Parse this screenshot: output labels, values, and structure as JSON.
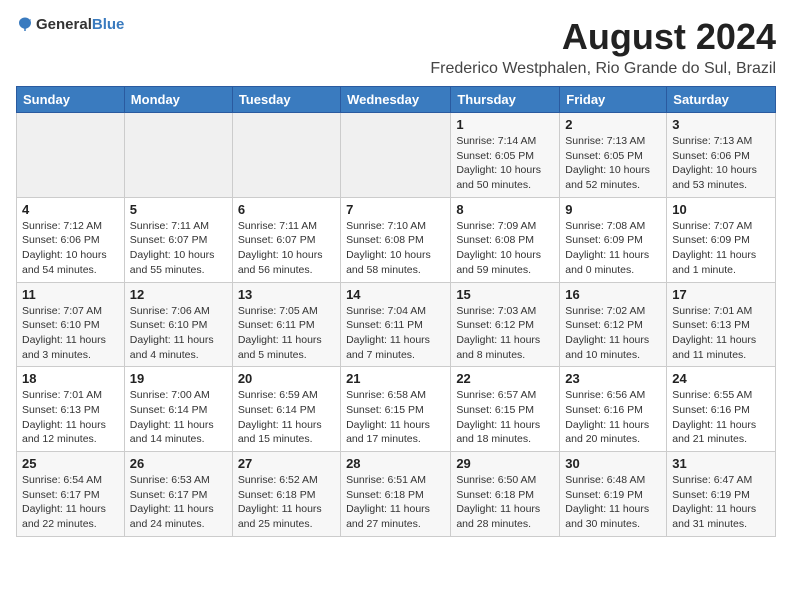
{
  "header": {
    "logo_general": "General",
    "logo_blue": "Blue",
    "title": "August 2024",
    "subtitle": "Frederico Westphalen, Rio Grande do Sul, Brazil"
  },
  "weekdays": [
    "Sunday",
    "Monday",
    "Tuesday",
    "Wednesday",
    "Thursday",
    "Friday",
    "Saturday"
  ],
  "weeks": [
    [
      {
        "day": "",
        "info": ""
      },
      {
        "day": "",
        "info": ""
      },
      {
        "day": "",
        "info": ""
      },
      {
        "day": "",
        "info": ""
      },
      {
        "day": "1",
        "info": "Sunrise: 7:14 AM\nSunset: 6:05 PM\nDaylight: 10 hours\nand 50 minutes."
      },
      {
        "day": "2",
        "info": "Sunrise: 7:13 AM\nSunset: 6:05 PM\nDaylight: 10 hours\nand 52 minutes."
      },
      {
        "day": "3",
        "info": "Sunrise: 7:13 AM\nSunset: 6:06 PM\nDaylight: 10 hours\nand 53 minutes."
      }
    ],
    [
      {
        "day": "4",
        "info": "Sunrise: 7:12 AM\nSunset: 6:06 PM\nDaylight: 10 hours\nand 54 minutes."
      },
      {
        "day": "5",
        "info": "Sunrise: 7:11 AM\nSunset: 6:07 PM\nDaylight: 10 hours\nand 55 minutes."
      },
      {
        "day": "6",
        "info": "Sunrise: 7:11 AM\nSunset: 6:07 PM\nDaylight: 10 hours\nand 56 minutes."
      },
      {
        "day": "7",
        "info": "Sunrise: 7:10 AM\nSunset: 6:08 PM\nDaylight: 10 hours\nand 58 minutes."
      },
      {
        "day": "8",
        "info": "Sunrise: 7:09 AM\nSunset: 6:08 PM\nDaylight: 10 hours\nand 59 minutes."
      },
      {
        "day": "9",
        "info": "Sunrise: 7:08 AM\nSunset: 6:09 PM\nDaylight: 11 hours\nand 0 minutes."
      },
      {
        "day": "10",
        "info": "Sunrise: 7:07 AM\nSunset: 6:09 PM\nDaylight: 11 hours\nand 1 minute."
      }
    ],
    [
      {
        "day": "11",
        "info": "Sunrise: 7:07 AM\nSunset: 6:10 PM\nDaylight: 11 hours\nand 3 minutes."
      },
      {
        "day": "12",
        "info": "Sunrise: 7:06 AM\nSunset: 6:10 PM\nDaylight: 11 hours\nand 4 minutes."
      },
      {
        "day": "13",
        "info": "Sunrise: 7:05 AM\nSunset: 6:11 PM\nDaylight: 11 hours\nand 5 minutes."
      },
      {
        "day": "14",
        "info": "Sunrise: 7:04 AM\nSunset: 6:11 PM\nDaylight: 11 hours\nand 7 minutes."
      },
      {
        "day": "15",
        "info": "Sunrise: 7:03 AM\nSunset: 6:12 PM\nDaylight: 11 hours\nand 8 minutes."
      },
      {
        "day": "16",
        "info": "Sunrise: 7:02 AM\nSunset: 6:12 PM\nDaylight: 11 hours\nand 10 minutes."
      },
      {
        "day": "17",
        "info": "Sunrise: 7:01 AM\nSunset: 6:13 PM\nDaylight: 11 hours\nand 11 minutes."
      }
    ],
    [
      {
        "day": "18",
        "info": "Sunrise: 7:01 AM\nSunset: 6:13 PM\nDaylight: 11 hours\nand 12 minutes."
      },
      {
        "day": "19",
        "info": "Sunrise: 7:00 AM\nSunset: 6:14 PM\nDaylight: 11 hours\nand 14 minutes."
      },
      {
        "day": "20",
        "info": "Sunrise: 6:59 AM\nSunset: 6:14 PM\nDaylight: 11 hours\nand 15 minutes."
      },
      {
        "day": "21",
        "info": "Sunrise: 6:58 AM\nSunset: 6:15 PM\nDaylight: 11 hours\nand 17 minutes."
      },
      {
        "day": "22",
        "info": "Sunrise: 6:57 AM\nSunset: 6:15 PM\nDaylight: 11 hours\nand 18 minutes."
      },
      {
        "day": "23",
        "info": "Sunrise: 6:56 AM\nSunset: 6:16 PM\nDaylight: 11 hours\nand 20 minutes."
      },
      {
        "day": "24",
        "info": "Sunrise: 6:55 AM\nSunset: 6:16 PM\nDaylight: 11 hours\nand 21 minutes."
      }
    ],
    [
      {
        "day": "25",
        "info": "Sunrise: 6:54 AM\nSunset: 6:17 PM\nDaylight: 11 hours\nand 22 minutes."
      },
      {
        "day": "26",
        "info": "Sunrise: 6:53 AM\nSunset: 6:17 PM\nDaylight: 11 hours\nand 24 minutes."
      },
      {
        "day": "27",
        "info": "Sunrise: 6:52 AM\nSunset: 6:18 PM\nDaylight: 11 hours\nand 25 minutes."
      },
      {
        "day": "28",
        "info": "Sunrise: 6:51 AM\nSunset: 6:18 PM\nDaylight: 11 hours\nand 27 minutes."
      },
      {
        "day": "29",
        "info": "Sunrise: 6:50 AM\nSunset: 6:18 PM\nDaylight: 11 hours\nand 28 minutes."
      },
      {
        "day": "30",
        "info": "Sunrise: 6:48 AM\nSunset: 6:19 PM\nDaylight: 11 hours\nand 30 minutes."
      },
      {
        "day": "31",
        "info": "Sunrise: 6:47 AM\nSunset: 6:19 PM\nDaylight: 11 hours\nand 31 minutes."
      }
    ]
  ]
}
